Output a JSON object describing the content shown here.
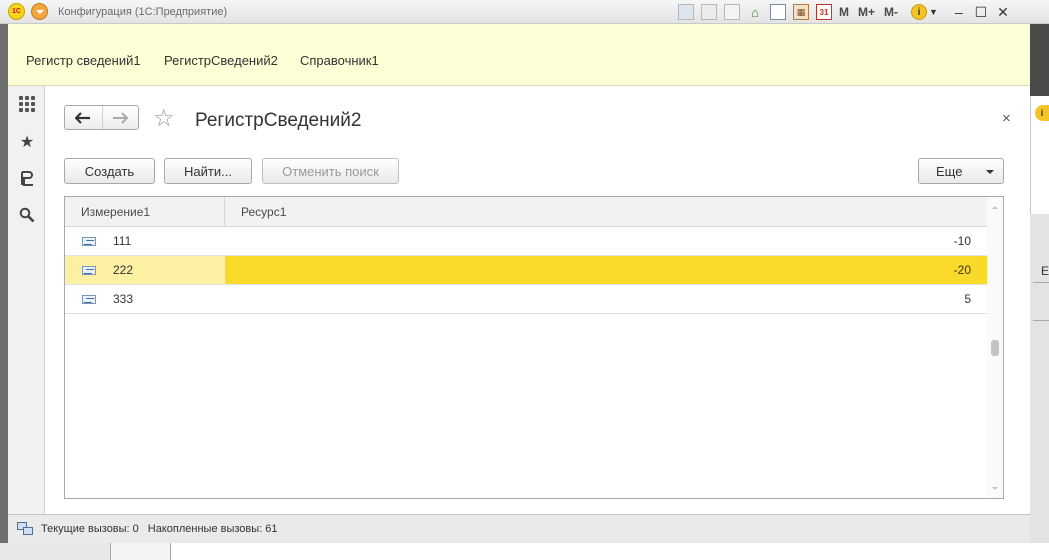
{
  "titlebar": {
    "title": "Конфигурация  (1С:Предприятие)",
    "logo_text": "1С",
    "m_label": "M",
    "mplus_label": "M+",
    "mminus_label": "M-",
    "info_label": "i",
    "minimize": "–",
    "maximize": "☐",
    "close": "✕"
  },
  "sections": {
    "items": [
      {
        "label": "Регистр сведений1"
      },
      {
        "label": "РегистрСведений2"
      },
      {
        "label": "Справочник1"
      }
    ]
  },
  "form": {
    "title": "РегистрСведений2",
    "back_glyph": "🡐",
    "forward_glyph": "🡒",
    "favorite_glyph": "☆",
    "close_glyph": "×"
  },
  "toolbar": {
    "create_label": "Создать",
    "find_label": "Найти...",
    "cancel_search_label": "Отменить поиск",
    "more_label": "Еще"
  },
  "table": {
    "columns": [
      "Измерение1",
      "Ресурс1"
    ],
    "rows": [
      {
        "dimension": "111",
        "resource": "-10",
        "selected": false
      },
      {
        "dimension": "222",
        "resource": "-20",
        "selected": true
      },
      {
        "dimension": "333",
        "resource": "5",
        "selected": false
      }
    ]
  },
  "statusbar": {
    "current_calls": "Текущие вызовы: 0",
    "accumulated_calls": "Накопленные вызовы: 61"
  },
  "background": {
    "right_letter": "Е"
  },
  "colors": {
    "sections_bg": "#fefed6",
    "selected_row": "#f9da2a",
    "selected_row_light": "#fcf0a2"
  }
}
